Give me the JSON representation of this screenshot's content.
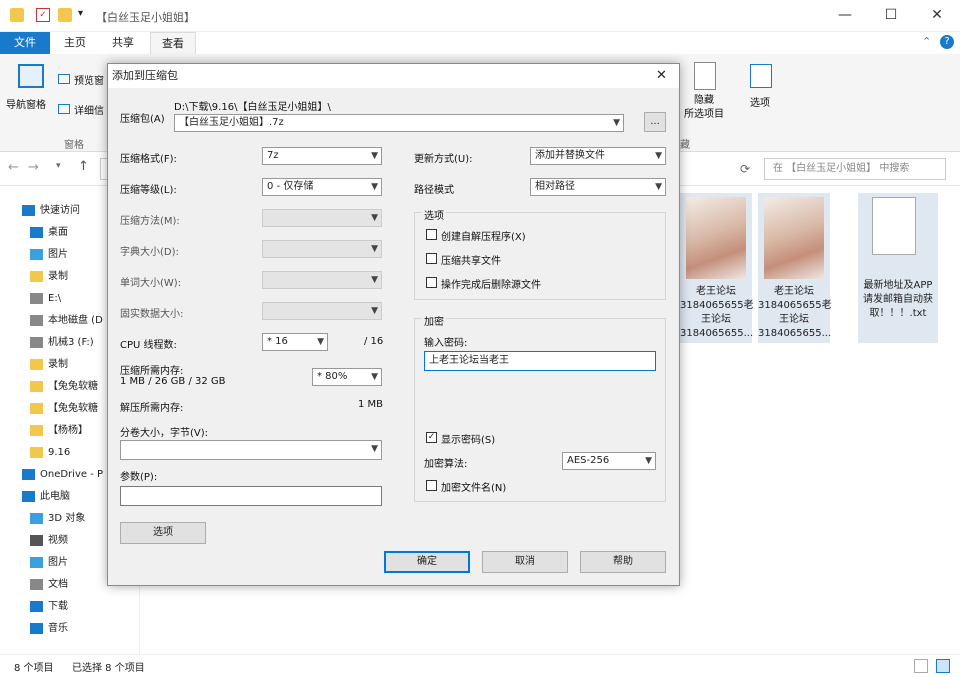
{
  "window": {
    "title": "【白丝玉足小姐姐】",
    "minimize": "—",
    "maximize": "☐",
    "close": "✕"
  },
  "ribbon": {
    "tabs": [
      "文件",
      "主页",
      "共享",
      "查看"
    ],
    "help": "?",
    "items": {
      "nav_pane": "导航窗格",
      "preview_pane": "预览窗",
      "details_pane": "详细信",
      "group_pane": "窗格",
      "hide_selected": "隐藏\n所选项目",
      "options": "选项",
      "group_show": "藏"
    }
  },
  "address": {
    "search_placeholder": "在 【白丝玉足小姐姐】 中搜索"
  },
  "nav": {
    "items": [
      {
        "label": "快速访问",
        "icon": "star-icon"
      },
      {
        "label": "桌面",
        "icon": "desktop-icon"
      },
      {
        "label": "图片",
        "icon": "pictures-icon"
      },
      {
        "label": "录制",
        "icon": "folder-icon"
      },
      {
        "label": "E:\\",
        "icon": "drive-icon"
      },
      {
        "label": "本地磁盘 (D",
        "icon": "drive-icon"
      },
      {
        "label": "机械3 (F:)",
        "icon": "drive-icon"
      },
      {
        "label": "录制",
        "icon": "folder-icon"
      },
      {
        "label": "【兔兔软糖",
        "icon": "folder-icon"
      },
      {
        "label": "【兔兔软糖",
        "icon": "folder-icon"
      },
      {
        "label": "【杨杨】",
        "icon": "folder-icon"
      },
      {
        "label": "9.16",
        "icon": "folder-icon"
      },
      {
        "label": "OneDrive - P",
        "icon": "cloud-icon"
      },
      {
        "label": "此电脑",
        "icon": "pc-icon"
      },
      {
        "label": "3D 对象",
        "icon": "cube-icon"
      },
      {
        "label": "视频",
        "icon": "video-icon"
      },
      {
        "label": "图片",
        "icon": "pictures-icon"
      },
      {
        "label": "文档",
        "icon": "documents-icon"
      },
      {
        "label": "下载",
        "icon": "download-icon"
      },
      {
        "label": "音乐",
        "icon": "music-icon"
      }
    ]
  },
  "files": [
    {
      "name": "老王论坛\n3184065655老\n王论坛\n3184065655..."
    },
    {
      "name": "老王论坛\n3184065655老\n王论坛\n3184065655..."
    },
    {
      "name": "最新地址及APP\n请发邮箱自动获\n取！！！.txt"
    }
  ],
  "status": {
    "count": "8 个项目",
    "selected": "已选择 8 个项目"
  },
  "dialog": {
    "title": "添加到压缩包",
    "archive_label": "压缩包(A)",
    "archive_path": "D:\\下载\\9.16\\【白丝玉足小姐姐】\\",
    "archive_name": "【白丝玉足小姐姐】.7z",
    "browse": "...",
    "format_label": "压缩格式(F):",
    "format_value": "7z",
    "level_label": "压缩等级(L):",
    "level_value": "0 - 仅存储",
    "method_label": "压缩方法(M):",
    "dict_label": "字典大小(D):",
    "word_label": "单词大小(W):",
    "solid_label": "固实数据大小:",
    "cpu_label": "CPU 线程数:",
    "cpu_value": "* 16",
    "cpu_total": "/ 16",
    "mem_label": "压缩所需内存:",
    "mem_value": "1 MB / 26 GB / 32 GB",
    "mem_pct": "* 80%",
    "decomp_label": "解压所需内存:",
    "decomp_value": "1 MB",
    "split_label": "分卷大小，字节(V):",
    "params_label": "参数(P):",
    "options_btn": "选项",
    "update_label": "更新方式(U):",
    "update_value": "添加并替换文件",
    "path_label": "路径模式",
    "path_value": "相对路径",
    "options_group": "选项",
    "opt_sfx": "创建自解压程序(X)",
    "opt_shared": "压缩共享文件",
    "opt_delete": "操作完成后删除源文件",
    "enc_group": "加密",
    "pwd_label": "输入密码:",
    "pwd_value": "上老王论坛当老王",
    "show_pwd": "显示密码(S)",
    "enc_method_label": "加密算法:",
    "enc_method_value": "AES-256",
    "enc_names": "加密文件名(N)",
    "ok": "确定",
    "cancel": "取消",
    "help": "帮助",
    "close": "✕"
  }
}
